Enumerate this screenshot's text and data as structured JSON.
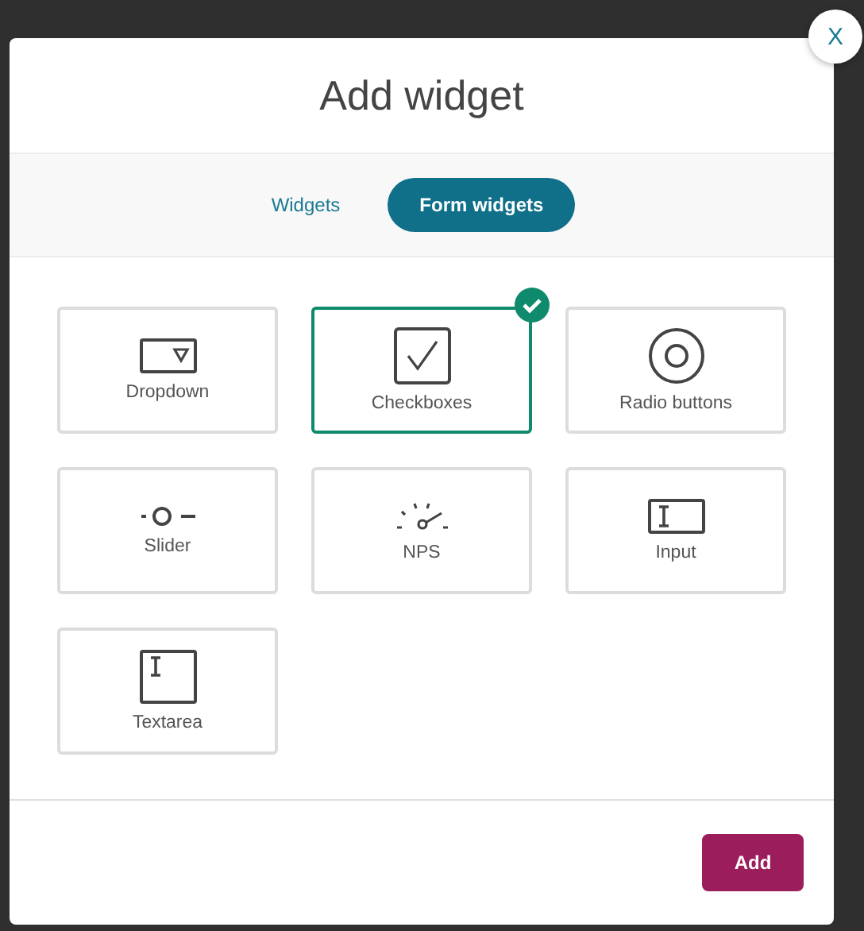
{
  "dialog": {
    "title": "Add widget",
    "close": "X"
  },
  "tabs": [
    {
      "label": "Widgets",
      "selected": false
    },
    {
      "label": "Form widgets",
      "selected": true
    }
  ],
  "widgets": [
    {
      "kind": "dropdown",
      "label": "Dropdown",
      "selected": false
    },
    {
      "kind": "checkbox",
      "label": "Checkboxes",
      "selected": true
    },
    {
      "kind": "radio",
      "label": "Radio buttons",
      "selected": false
    },
    {
      "kind": "slider",
      "label": "Slider",
      "selected": false
    },
    {
      "kind": "nps",
      "label": "NPS",
      "selected": false
    },
    {
      "kind": "input",
      "label": "Input",
      "selected": false
    },
    {
      "kind": "textarea",
      "label": "Textarea",
      "selected": false
    }
  ],
  "footer": {
    "button": "Add"
  }
}
